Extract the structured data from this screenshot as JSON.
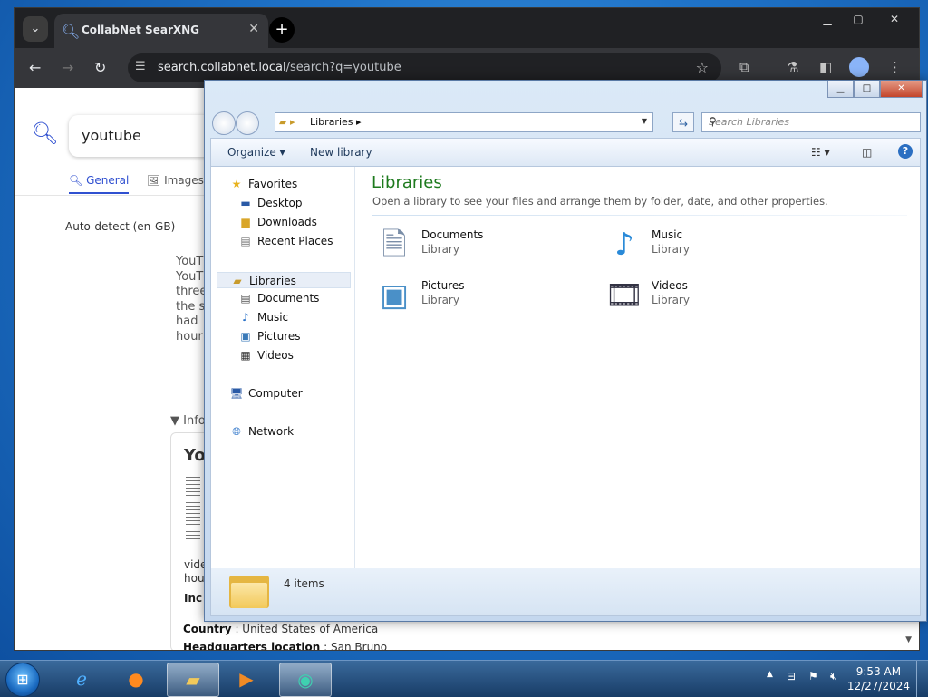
{
  "browser": {
    "tab_title": "CollabNet SearXNG",
    "url_host": "search.collabnet.local",
    "url_path": "/search?q=youtube",
    "search_query": "youtube",
    "categories": [
      "General",
      "Images"
    ],
    "language": "Auto-detect (en-GB)",
    "snippet_lines": [
      "YouT",
      "YouT",
      "three",
      "the s",
      "had",
      "hour"
    ],
    "info_toggle": "Info",
    "card": {
      "title": "Yo",
      "lines": [
        "vide",
        "hou"
      ],
      "inc_label": "Inc",
      "country_label": "Country",
      "country_value": "United States of America",
      "hq_label": "Headquarters location",
      "hq_value": "San Bruno"
    }
  },
  "explorer": {
    "breadcrumb": "Libraries",
    "search_placeholder": "Search Libraries",
    "commands": {
      "organize": "Organize",
      "new_library": "New library"
    },
    "nav": {
      "favorites": "Favorites",
      "favorites_items": [
        "Desktop",
        "Downloads",
        "Recent Places"
      ],
      "libraries": "Libraries",
      "libraries_items": [
        "Documents",
        "Music",
        "Pictures",
        "Videos"
      ],
      "computer": "Computer",
      "network": "Network"
    },
    "heading": "Libraries",
    "subheading": "Open a library to see your files and arrange them by folder, date, and other properties.",
    "libraries": [
      {
        "name": "Documents",
        "type": "Library",
        "icon": "documents-library-icon"
      },
      {
        "name": "Music",
        "type": "Library",
        "icon": "music-library-icon"
      },
      {
        "name": "Pictures",
        "type": "Library",
        "icon": "pictures-library-icon"
      },
      {
        "name": "Videos",
        "type": "Library",
        "icon": "videos-library-icon"
      }
    ],
    "item_count": "4 items"
  },
  "taskbar": {
    "time": "9:53 AM",
    "date": "12/27/2024"
  }
}
